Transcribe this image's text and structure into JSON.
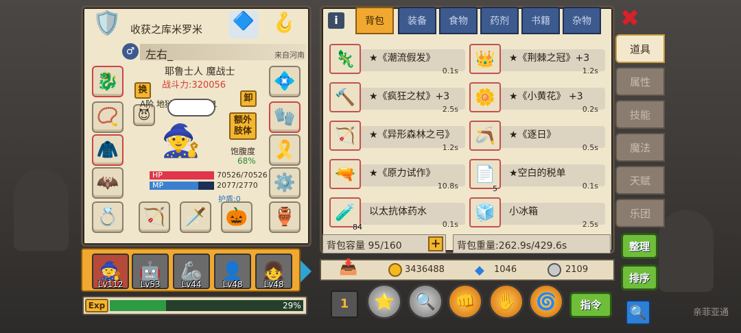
{
  "character": {
    "title": "收获之库米罗米",
    "name": "左右_",
    "origin": "来自河南",
    "class": "耶鲁士人 魔战士",
    "power": "战斗力:320056",
    "swap_label": "换",
    "unequip_label": "卸",
    "extra_body_label": "额外肢体",
    "rank": "A阶 地狱使徒: Lv 61",
    "satiety_label": "饱腹度",
    "satiety_value": "68%",
    "hp_label": "HP",
    "hp_value": "70526/70526",
    "hp_fraction": 1.0,
    "mp_label": "MP",
    "mp_value": "2077/2770",
    "mp_fraction": 0.75,
    "shield": "护盾:0"
  },
  "party": [
    {
      "level": "Lv112"
    },
    {
      "level": "Lv53"
    },
    {
      "level": "Lv44"
    },
    {
      "level": "Lv48"
    },
    {
      "level": "Lv48"
    }
  ],
  "exp": {
    "label": "Exp",
    "percent_text": "29%",
    "fraction": 0.29
  },
  "inventory_tabs": [
    "背包",
    "装备",
    "食物",
    "药剂",
    "书籍",
    "杂物"
  ],
  "items": [
    {
      "name": "★《潮流假发》",
      "weight": "0.1s",
      "icon": "🦎",
      "count": ""
    },
    {
      "name": "★《荆棘之冠》+3",
      "weight": "1.2s",
      "icon": "👑",
      "count": ""
    },
    {
      "name": "★《疯狂之杖》+3",
      "weight": "2.5s",
      "icon": "🔨",
      "count": ""
    },
    {
      "name": "★《小黄花》 +3",
      "weight": "0.2s",
      "icon": "🌼",
      "count": ""
    },
    {
      "name": "★《异形森林之弓》",
      "weight": "1.2s",
      "icon": "🏹",
      "count": ""
    },
    {
      "name": "★《逐日》",
      "weight": "0.5s",
      "icon": "🪃",
      "count": ""
    },
    {
      "name": "★《原力试作》",
      "weight": "10.8s",
      "icon": "🔫",
      "count": ""
    },
    {
      "name": "★空白的税单",
      "weight": "0.1s",
      "icon": "📄",
      "count": "5"
    },
    {
      "name": "以太抗体药水",
      "weight": "0.1s",
      "icon": "🧪",
      "count": "84"
    },
    {
      "name": "小冰箱",
      "weight": "2.5s",
      "icon": "🧊",
      "count": ""
    }
  ],
  "capacity": "背包容量 95/160",
  "weight": "背包重量:262.9s/429.6s",
  "currency": {
    "gold": "3436488",
    "gems": "1046",
    "silver": "2109"
  },
  "side_tabs": [
    "道具",
    "属性",
    "技能",
    "魔法",
    "天赋",
    "乐团"
  ],
  "buttons": {
    "sort1": "整理",
    "sort2": "排序",
    "command": "指令"
  },
  "background_text": "亲菲亚通"
}
